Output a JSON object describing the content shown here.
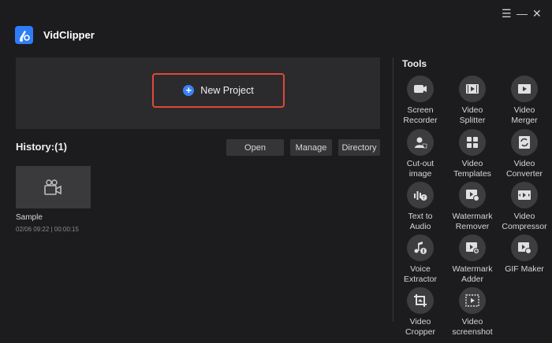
{
  "window_controls": {
    "menu": "☰",
    "minimize": "—",
    "close": "✕"
  },
  "app": {
    "title": "VidClipper"
  },
  "new_project": {
    "label": "New Project"
  },
  "history": {
    "title": "History:(1)",
    "buttons": {
      "open": "Open",
      "manage": "Manage",
      "directory": "Directory"
    },
    "projects": [
      {
        "name": "Sample",
        "meta": "02/06 09:22 | 00:00:15"
      }
    ]
  },
  "tools": {
    "header": "Tools",
    "items": [
      {
        "label": "Screen\nRecorder",
        "icon": "screen-recorder-icon"
      },
      {
        "label": "Video\nSplitter",
        "icon": "video-splitter-icon"
      },
      {
        "label": "Video\nMerger",
        "icon": "video-merger-icon"
      },
      {
        "label": "Cut-out\nimage",
        "icon": "cutout-image-icon"
      },
      {
        "label": "Video\nTemplates",
        "icon": "video-templates-icon"
      },
      {
        "label": "Video\nConverter",
        "icon": "video-converter-icon"
      },
      {
        "label": "Text to\nAudio",
        "icon": "text-to-audio-icon"
      },
      {
        "label": "Watermark\nRemover",
        "icon": "watermark-remover-icon"
      },
      {
        "label": "Video\nCompressor",
        "icon": "video-compressor-icon"
      },
      {
        "label": "Voice\nExtractor",
        "icon": "voice-extractor-icon"
      },
      {
        "label": "Watermark\nAdder",
        "icon": "watermark-adder-icon"
      },
      {
        "label": "GIF Maker",
        "icon": "gif-maker-icon"
      },
      {
        "label": "Video\nCropper",
        "icon": "video-cropper-icon"
      },
      {
        "label": "Video\nscreenshot",
        "icon": "video-screenshot-icon"
      }
    ]
  }
}
